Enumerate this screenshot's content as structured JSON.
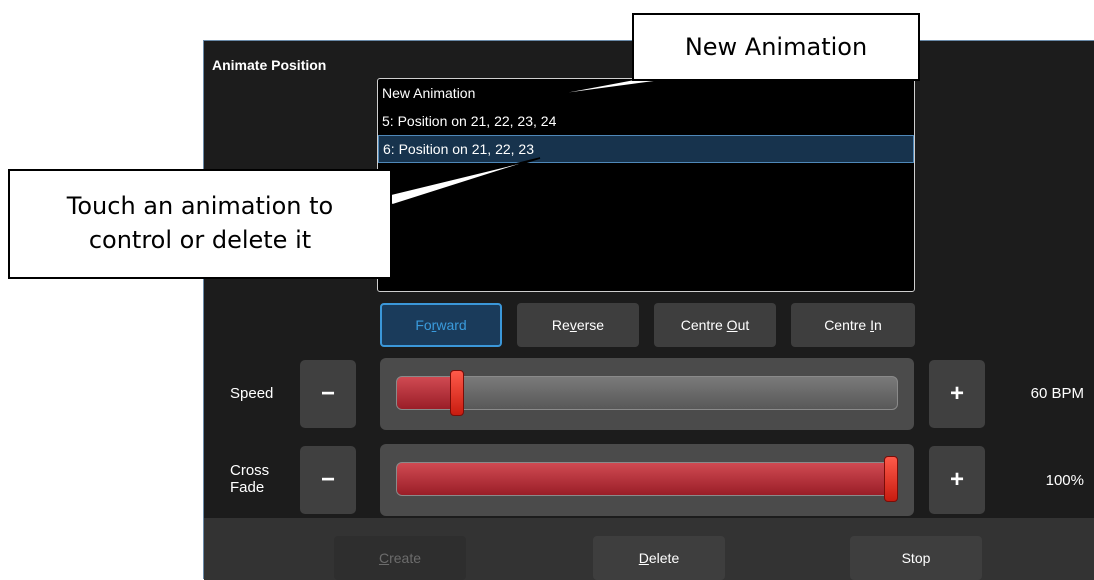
{
  "panel": {
    "title": "Animate Position",
    "list": [
      {
        "label": "New Animation",
        "selected": false
      },
      {
        "label": "5: Position on 21, 22, 23, 24",
        "selected": false
      },
      {
        "label": "6: Position on 21, 22, 23",
        "selected": true
      }
    ],
    "direction_buttons": [
      {
        "pre": "Fo",
        "u": "r",
        "post": "ward",
        "active": true
      },
      {
        "pre": "Re",
        "u": "v",
        "post": "erse",
        "active": false
      },
      {
        "pre": "Centre ",
        "u": "O",
        "post": "ut",
        "active": false
      },
      {
        "pre": "Centre ",
        "u": "I",
        "post": "n",
        "active": false
      }
    ],
    "speed": {
      "label": "Speed",
      "minus": "−",
      "plus": "+",
      "value_text": "60 BPM",
      "level": 0.11
    },
    "crossfade": {
      "label_line1": "Cross",
      "label_line2": "Fade",
      "minus": "−",
      "plus": "+",
      "value_text": "100%",
      "level": 1.0
    },
    "bottom_buttons": {
      "create": {
        "u": "C",
        "post": "reate",
        "disabled": true
      },
      "delete": {
        "u": "D",
        "post": "elete"
      },
      "stop": {
        "label": "Stop"
      }
    }
  },
  "callouts": {
    "new_animation": "New Animation",
    "touch_line1": "Touch an animation to",
    "touch_line2": "control or delete it"
  },
  "colors": {
    "selected_row": "#17334d",
    "active_button_border": "#3b97d9",
    "slider_fill": "#b0323a",
    "slider_handle": "#e8352a"
  }
}
